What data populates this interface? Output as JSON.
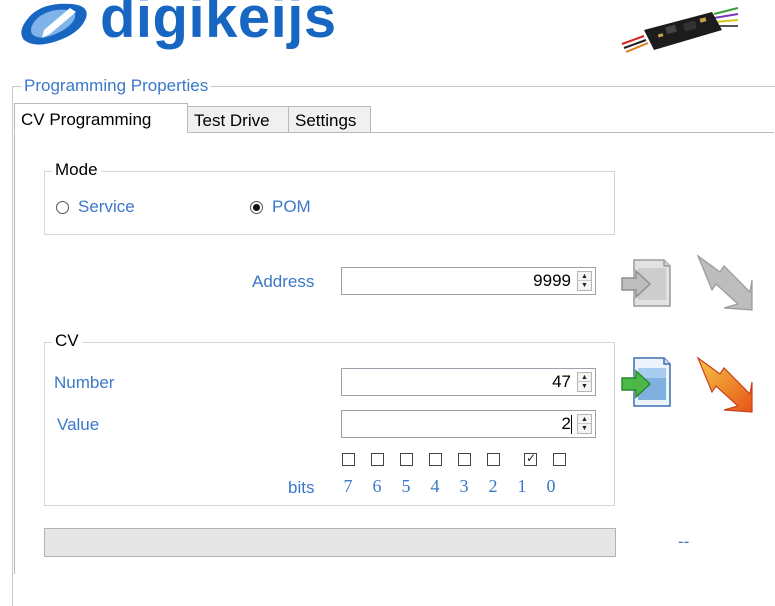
{
  "header": {
    "brand": "digikeijs",
    "registered_mark": "®"
  },
  "programming": {
    "group_title": "Programming Properties",
    "tabs": [
      {
        "label": "CV Programming",
        "active": true
      },
      {
        "label": "Test Drive",
        "active": false
      },
      {
        "label": "Settings",
        "active": false
      }
    ],
    "mode": {
      "title": "Mode",
      "options": [
        {
          "label": "Service",
          "checked": false
        },
        {
          "label": "POM",
          "checked": true
        }
      ]
    },
    "address": {
      "label": "Address",
      "value": "9999"
    },
    "cv": {
      "title": "CV",
      "number_label": "Number",
      "number_value": "47",
      "value_label": "Value",
      "value_value": "2",
      "bits_label": "bits",
      "bits": [
        {
          "num": "7",
          "checked": false
        },
        {
          "num": "6",
          "checked": false
        },
        {
          "num": "5",
          "checked": false
        },
        {
          "num": "4",
          "checked": false
        },
        {
          "num": "3",
          "checked": false
        },
        {
          "num": "2",
          "checked": false
        },
        {
          "num": "1",
          "checked": true
        },
        {
          "num": "0",
          "checked": false
        }
      ]
    },
    "status_text": "--"
  },
  "icons": {
    "read_address": "read-address-icon",
    "write_address": "write-address-icon",
    "read_cv": "read-cv-icon",
    "write_cv": "write-cv-icon"
  },
  "colors": {
    "brand_blue": "#1766c1",
    "label_blue": "#3b78c8",
    "write_active_orange": "#f08a1c",
    "disabled_gray": "#b5b5b5",
    "arrow_green": "#4cb848"
  }
}
